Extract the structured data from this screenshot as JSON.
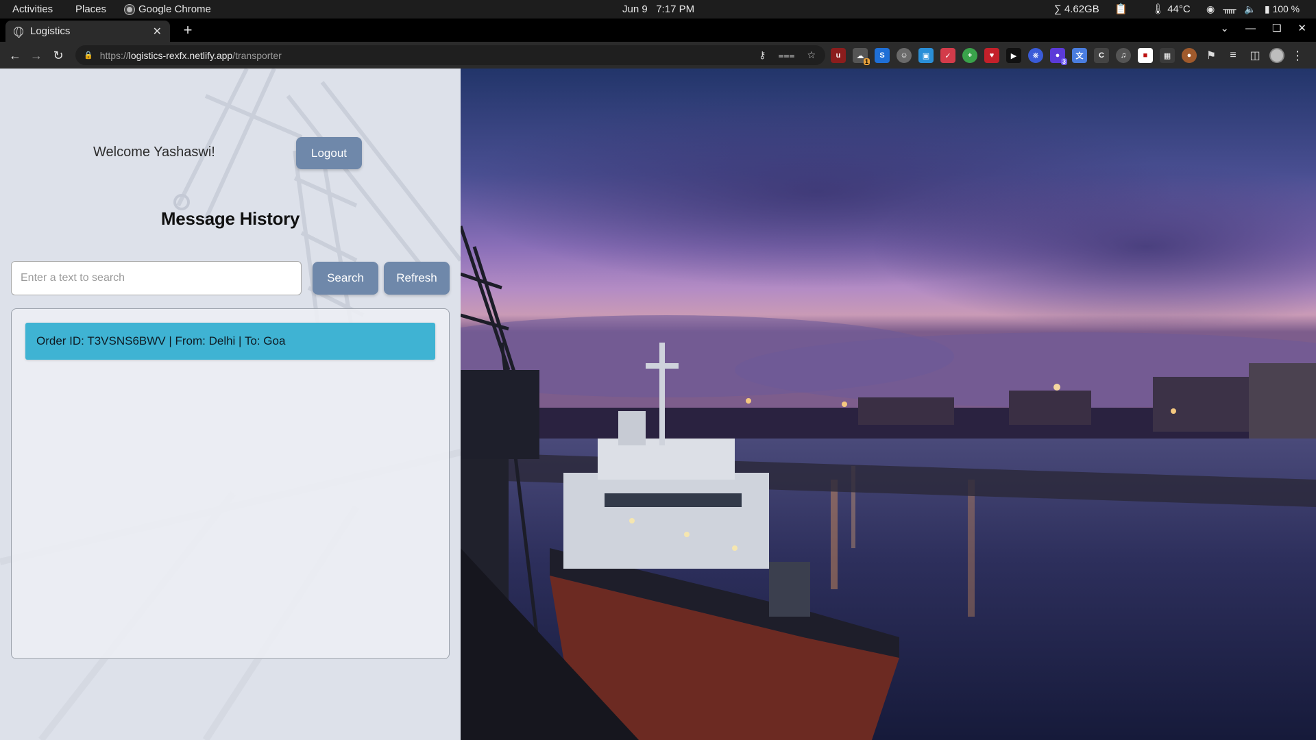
{
  "system_bar": {
    "activities": "Activities",
    "places": "Places",
    "app_name": "Google Chrome",
    "date": "Jun 9",
    "time": "7:17 PM",
    "memory": "∑ 4.62GB",
    "temperature": "44°C",
    "battery": "100 %"
  },
  "browser": {
    "tab_title": "Logistics",
    "url_scheme": "https://",
    "url_host": "logistics-rexfx.netlify.app",
    "url_path": "/transporter",
    "extension_badges": {
      "ext_1": "1",
      "ext_3": "3"
    }
  },
  "page": {
    "welcome_text": "Welcome Yashaswi!",
    "logout_label": "Logout",
    "title": "Message History",
    "search": {
      "placeholder": "Enter a text to search",
      "value": ""
    },
    "search_label": "Search",
    "refresh_label": "Refresh",
    "messages": [
      {
        "text": "Order ID: T3VSNS6BWV | From: Delhi | To: Goa"
      }
    ]
  },
  "colors": {
    "button_bg": "#6f88aa",
    "message_bg": "#3fb3d3",
    "panel_bg": "#dfe3ec"
  }
}
